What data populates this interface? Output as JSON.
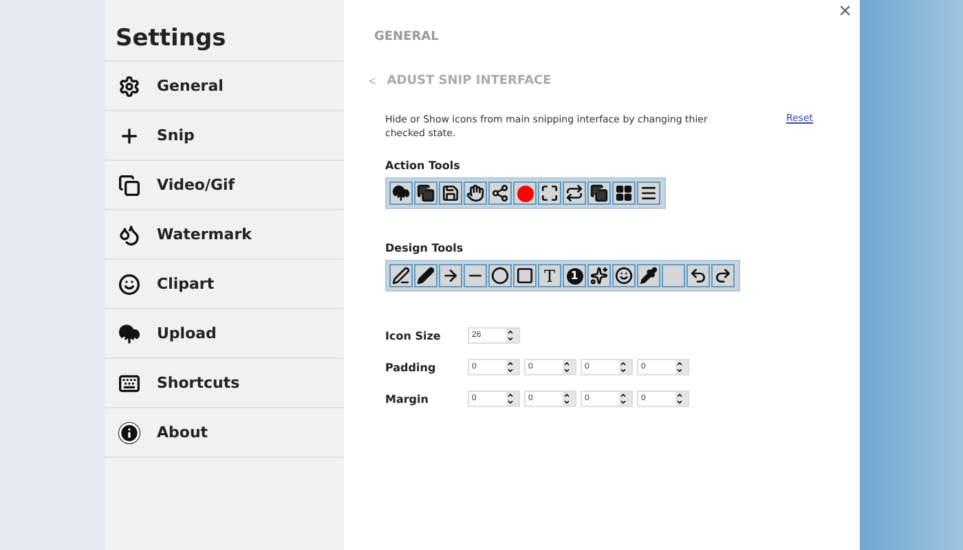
{
  "sidebar": {
    "title": "Settings",
    "items": [
      {
        "label": "General"
      },
      {
        "label": "Snip"
      },
      {
        "label": "Video/Gif"
      },
      {
        "label": "Watermark"
      },
      {
        "label": "Clipart"
      },
      {
        "label": "Upload"
      },
      {
        "label": "Shortcuts"
      },
      {
        "label": "About"
      }
    ]
  },
  "close": "×",
  "section": "GENERAL",
  "back": {
    "arrow": "<",
    "label": "ADUST SNIP INTERFACE"
  },
  "description": "Hide or Show icons from main snipping interface by changing thier checked state.",
  "reset": "Reset",
  "action_tools": {
    "title": "Action Tools"
  },
  "design_tools": {
    "title": "Design Tools",
    "text_tool": "T",
    "number_tool": "1"
  },
  "settings": [
    {
      "label": "Icon Size",
      "values": [
        "26"
      ]
    },
    {
      "label": "Padding",
      "values": [
        "0",
        "0",
        "0",
        "0"
      ]
    },
    {
      "label": "Margin",
      "values": [
        "0",
        "0",
        "0",
        "0"
      ]
    }
  ]
}
